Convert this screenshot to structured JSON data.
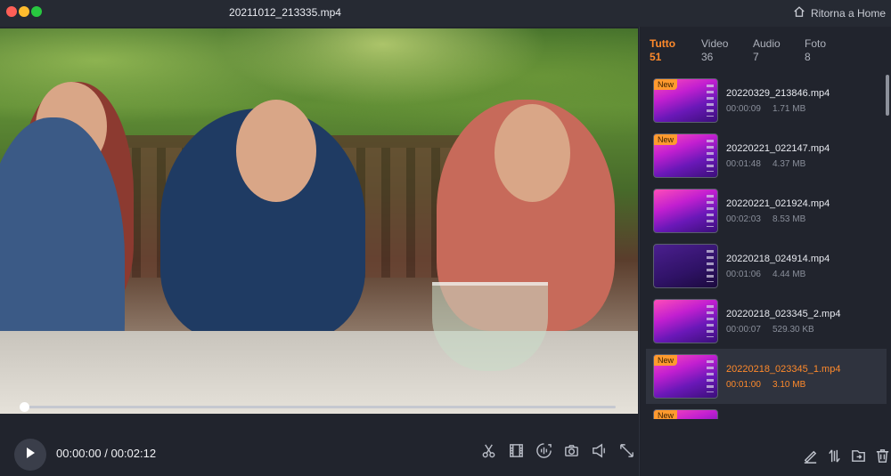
{
  "window": {
    "title": "20211012_213335.mp4",
    "home_label": "Ritorna a Home"
  },
  "player": {
    "current_time": "00:00:00",
    "separator": "/",
    "total_time": "00:02:12",
    "progress": 0.0,
    "tools": [
      "scissors-icon",
      "film-strip-icon",
      "audio-wave-icon",
      "camera-icon",
      "speaker-icon",
      "fullscreen-icon"
    ]
  },
  "sidebar": {
    "tabs": [
      {
        "label": "Tutto",
        "count": "51",
        "active": true
      },
      {
        "label": "Video",
        "count": "36",
        "active": false
      },
      {
        "label": "Audio",
        "count": "7",
        "active": false
      },
      {
        "label": "Foto",
        "count": "8",
        "active": false
      }
    ],
    "items": [
      {
        "name": "20220329_213846.mp4",
        "duration": "00:00:09",
        "size": "1.71 MB",
        "badge": "New"
      },
      {
        "name": "20220221_022147.mp4",
        "duration": "00:01:48",
        "size": "4.37 MB",
        "badge": "New"
      },
      {
        "name": "20220221_021924.mp4",
        "duration": "00:02:03",
        "size": "8.53 MB",
        "badge": ""
      },
      {
        "name": "20220218_024914.mp4",
        "duration": "00:01:06",
        "size": "4.44 MB",
        "badge": ""
      },
      {
        "name": "20220218_023345_2.mp4",
        "duration": "00:00:07",
        "size": "529.30 KB",
        "badge": ""
      },
      {
        "name": "20220218_023345_1.mp4",
        "duration": "00:01:00",
        "size": "3.10 MB",
        "badge": "New",
        "selected": true
      },
      {
        "name": "",
        "duration": "",
        "size": "",
        "badge": "New"
      }
    ],
    "tools": [
      "edit-icon",
      "sort-icon",
      "export-icon",
      "trash-icon"
    ]
  },
  "colors": {
    "accent": "#ff8a2b",
    "badge": "#ff9a2e",
    "background": "#1f222b"
  }
}
